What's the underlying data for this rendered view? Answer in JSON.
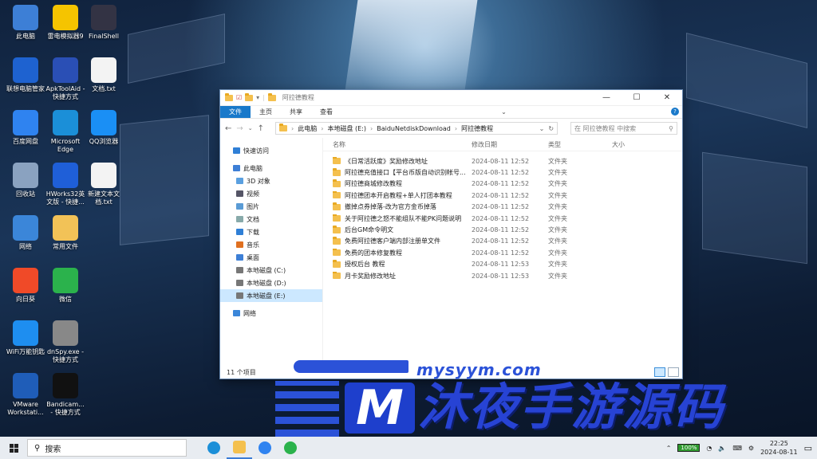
{
  "desktop_icons": [
    {
      "label": "此电脑",
      "color": "#3d7fd6"
    },
    {
      "label": "雷电模拟器9",
      "color": "#f5c400"
    },
    {
      "label": "FinalShell",
      "color": "#334"
    },
    {
      "label": "联想电脑管家",
      "color": "#1e62d0"
    },
    {
      "label": "ApkToolAid - 快捷方式",
      "color": "#2a4fb5"
    },
    {
      "label": "文档.txt",
      "color": "#f3f3f3"
    },
    {
      "label": "百度网盘",
      "color": "#2f83f0"
    },
    {
      "label": "Microsoft Edge",
      "color": "#1b8fd8"
    },
    {
      "label": "QQ浏览器",
      "color": "#1a8ff5"
    },
    {
      "label": "回收站",
      "color": "#8aa2c0"
    },
    {
      "label": "HWorks32英文版 - 快捷...",
      "color": "#1f5fd8"
    },
    {
      "label": "新建文本文档.txt",
      "color": "#f3f3f3"
    },
    {
      "label": "网络",
      "color": "#3b86d9"
    },
    {
      "label": "常用文件",
      "color": "#f2c257"
    },
    {
      "label": "向日葵",
      "color": "#f04a28"
    },
    {
      "label": "微信",
      "color": "#2bb24c"
    },
    {
      "label": "WiFi万能钥匙",
      "color": "#1e8ef0"
    },
    {
      "label": "dnSpy.exe - 快捷方式",
      "color": "#888"
    },
    {
      "label": "VMware Workstati...",
      "color": "#1f5db8"
    },
    {
      "label": "Bandicam... - 快捷方式",
      "color": "#111"
    }
  ],
  "explorer": {
    "title": "阿拉德教程",
    "ribbon_tabs": [
      "文件",
      "主页",
      "共享",
      "查看"
    ],
    "help": "?",
    "path": [
      "此电脑",
      "本地磁盘 (E:)",
      "BaiduNetdiskDownload",
      "阿拉德教程"
    ],
    "search_placeholder": "在 阿拉德教程 中搜索",
    "nav": [
      {
        "label": "快速访问",
        "type": "star",
        "indent": false
      },
      {
        "label": "此电脑",
        "type": "pc",
        "indent": false
      },
      {
        "label": "3D 对象",
        "type": "folder3d",
        "indent": true
      },
      {
        "label": "视频",
        "type": "video",
        "indent": true
      },
      {
        "label": "图片",
        "type": "pic",
        "indent": true
      },
      {
        "label": "文档",
        "type": "doc",
        "indent": true
      },
      {
        "label": "下载",
        "type": "down",
        "indent": true
      },
      {
        "label": "音乐",
        "type": "music",
        "indent": true
      },
      {
        "label": "桌面",
        "type": "desk",
        "indent": true
      },
      {
        "label": "本地磁盘 (C:)",
        "type": "drive",
        "indent": true
      },
      {
        "label": "本地磁盘 (D:)",
        "type": "drive",
        "indent": true
      },
      {
        "label": "本地磁盘 (E:)",
        "type": "drive",
        "indent": true,
        "selected": true
      },
      {
        "label": "网络",
        "type": "net",
        "indent": false
      }
    ],
    "columns": [
      "名称",
      "修改日期",
      "类型",
      "大小"
    ],
    "files": [
      {
        "name": "《日常活跃度》奖励修改地址",
        "date": "2024-08-11 12:52",
        "type": "文件夹"
      },
      {
        "name": "阿拉德充值接口【平台币版自动识别帐号...",
        "date": "2024-08-11 12:52",
        "type": "文件夹"
      },
      {
        "name": "阿拉德商城修改教程",
        "date": "2024-08-11 12:52",
        "type": "文件夹"
      },
      {
        "name": "阿拉德团本开启教程+单人打团本教程",
        "date": "2024-08-11 12:52",
        "type": "文件夹"
      },
      {
        "name": "撤掉点券掉落-改为官方金币掉落",
        "date": "2024-08-11 12:52",
        "type": "文件夹"
      },
      {
        "name": "关于阿拉德之怒不能组队不能PK问题说明",
        "date": "2024-08-11 12:52",
        "type": "文件夹"
      },
      {
        "name": "后台GM命令明文",
        "date": "2024-08-11 12:52",
        "type": "文件夹"
      },
      {
        "name": "免费阿拉德客户端内部注册单文件",
        "date": "2024-08-11 12:52",
        "type": "文件夹"
      },
      {
        "name": "免费的团本修复教程",
        "date": "2024-08-11 12:52",
        "type": "文件夹"
      },
      {
        "name": "授权后台 教程",
        "date": "2024-08-11 12:53",
        "type": "文件夹"
      },
      {
        "name": "月卡奖励修改地址",
        "date": "2024-08-11 12:53",
        "type": "文件夹"
      }
    ],
    "status": "11 个项目"
  },
  "watermark": {
    "url": "mysyym.com",
    "m": "M",
    "text": "沐夜手游源码"
  },
  "taskbar": {
    "search": "搜索",
    "apps": [
      "edge",
      "explorer",
      "baidunetdisk",
      "wechat"
    ],
    "battery": "100%",
    "time": "22:25",
    "date": "2024-08-11"
  }
}
